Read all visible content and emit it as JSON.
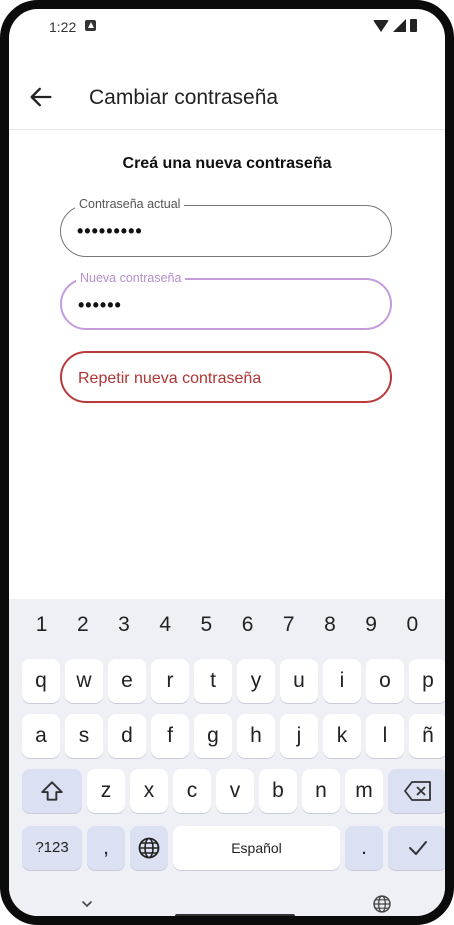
{
  "status_bar": {
    "time": "1:22"
  },
  "app_bar": {
    "title": "Cambiar contraseña"
  },
  "heading": "Creá una nueva contraseña",
  "fields": {
    "current": {
      "label": "Contraseña actual",
      "value": "•••••••••"
    },
    "new": {
      "label": "Nueva contraseña",
      "value": "••••••"
    },
    "repeat": {
      "placeholder": "Repetir nueva contraseña"
    }
  },
  "keyboard": {
    "numbers": [
      "1",
      "2",
      "3",
      "4",
      "5",
      "6",
      "7",
      "8",
      "9",
      "0"
    ],
    "row1": [
      "q",
      "w",
      "e",
      "r",
      "t",
      "y",
      "u",
      "i",
      "o",
      "p"
    ],
    "row2": [
      "a",
      "s",
      "d",
      "f",
      "g",
      "h",
      "j",
      "k",
      "l",
      "ñ"
    ],
    "row3": [
      "z",
      "x",
      "c",
      "v",
      "b",
      "n",
      "m"
    ],
    "symbols_label": "?123",
    "comma": ",",
    "space_label": "Español",
    "period": "."
  },
  "colors": {
    "accent_focus": "#c49bdc",
    "error": "#b83a3a",
    "keyboard_bg": "#eef0f6",
    "special_key": "#dbe0f3"
  }
}
